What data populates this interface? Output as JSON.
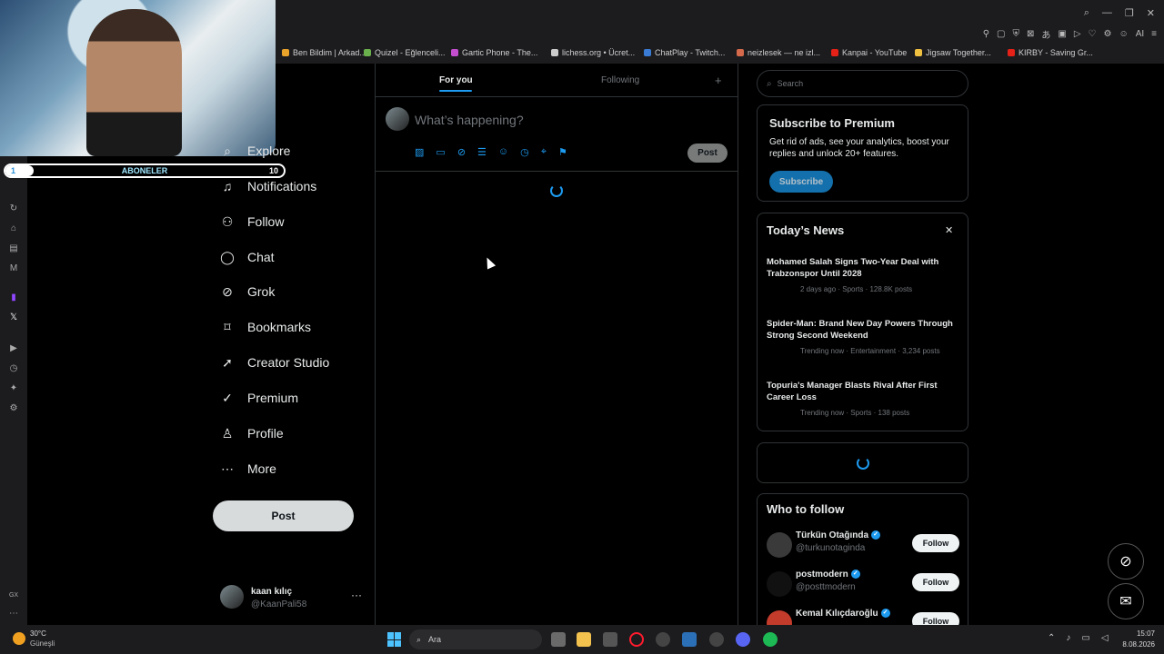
{
  "browser": {
    "bookmarks": [
      {
        "label": "Ben Bildim | Arkad...",
        "color": "#e9a32b"
      },
      {
        "label": "Quizel - Eğlenceli...",
        "color": "#6ab04c"
      },
      {
        "label": "Gartic Phone - The...",
        "color": "#c44ecf"
      },
      {
        "label": "lichess.org • Ücret...",
        "color": "#cccccc"
      },
      {
        "label": "ChatPlay - Twitch...",
        "color": "#3a7bd5"
      },
      {
        "label": "neizlesek — ne izl...",
        "color": "#d46a4b"
      },
      {
        "label": "Kanpai - YouTube",
        "color": "#e62117"
      },
      {
        "label": "Jigsaw Together...",
        "color": "#f0c040"
      },
      {
        "label": "KIRBY - Saving Gr...",
        "color": "#e62117"
      }
    ],
    "ai_label": "AI",
    "rail_label": "GX"
  },
  "overlay": {
    "subscriber_label": "ABONELER",
    "current": "1",
    "goal": "10",
    "progress": 0.1
  },
  "nav": {
    "items": [
      {
        "label": "Explore",
        "icon": "search-icon"
      },
      {
        "label": "Notifications",
        "icon": "bell-icon"
      },
      {
        "label": "Follow",
        "icon": "add-user-icon"
      },
      {
        "label": "Chat",
        "icon": "chat-icon"
      },
      {
        "label": "Grok",
        "icon": "grok-icon"
      },
      {
        "label": "Bookmarks",
        "icon": "bookmark-icon"
      },
      {
        "label": "Creator Studio",
        "icon": "rocket-icon"
      },
      {
        "label": "Premium",
        "icon": "verified-icon"
      },
      {
        "label": "Profile",
        "icon": "person-icon"
      },
      {
        "label": "More",
        "icon": "more-circle-icon"
      }
    ],
    "post_label": "Post",
    "account": {
      "name": "kaan kılıç",
      "handle": "@KaanPali58"
    }
  },
  "feed": {
    "tabs": [
      "For you",
      "Following"
    ],
    "active_tab": "For you",
    "compose_placeholder": "What’s happening?",
    "compose_post_label": "Post"
  },
  "sidebar": {
    "search_placeholder": "Search",
    "premium": {
      "title": "Subscribe to Premium",
      "body": "Get rid of ads, see your analytics, boost your replies and unlock 20+ features.",
      "button": "Subscribe"
    },
    "news": {
      "title": "Today’s News",
      "items": [
        {
          "title": "Mohamed Salah Signs Two-Year Deal with Trabzonspor Until 2028",
          "meta": "2 days ago · Sports · 128.8K posts"
        },
        {
          "title": "Spider-Man: Brand New Day Powers Through Strong Second Weekend",
          "meta": "Trending now · Entertainment · 3,234 posts"
        },
        {
          "title": "Topuria's Manager Blasts Rival After First Career Loss",
          "meta": "Trending now · Sports · 138 posts"
        }
      ]
    },
    "who_to_follow": {
      "title": "Who to follow",
      "users": [
        {
          "name": "Türkün Otağında",
          "handle": "@turkunotaginda",
          "button": "Follow"
        },
        {
          "name": "postmodern",
          "handle": "@posttmodern",
          "button": "Follow"
        },
        {
          "name": "Kemal Kılıçdaroğlu",
          "handle": "",
          "button": "Follow"
        }
      ]
    }
  },
  "taskbar": {
    "weather_temp": "30°C",
    "weather_desc": "Güneşli",
    "search_placeholder": "Ara",
    "time": "15:07",
    "date": "8.08.2026"
  }
}
